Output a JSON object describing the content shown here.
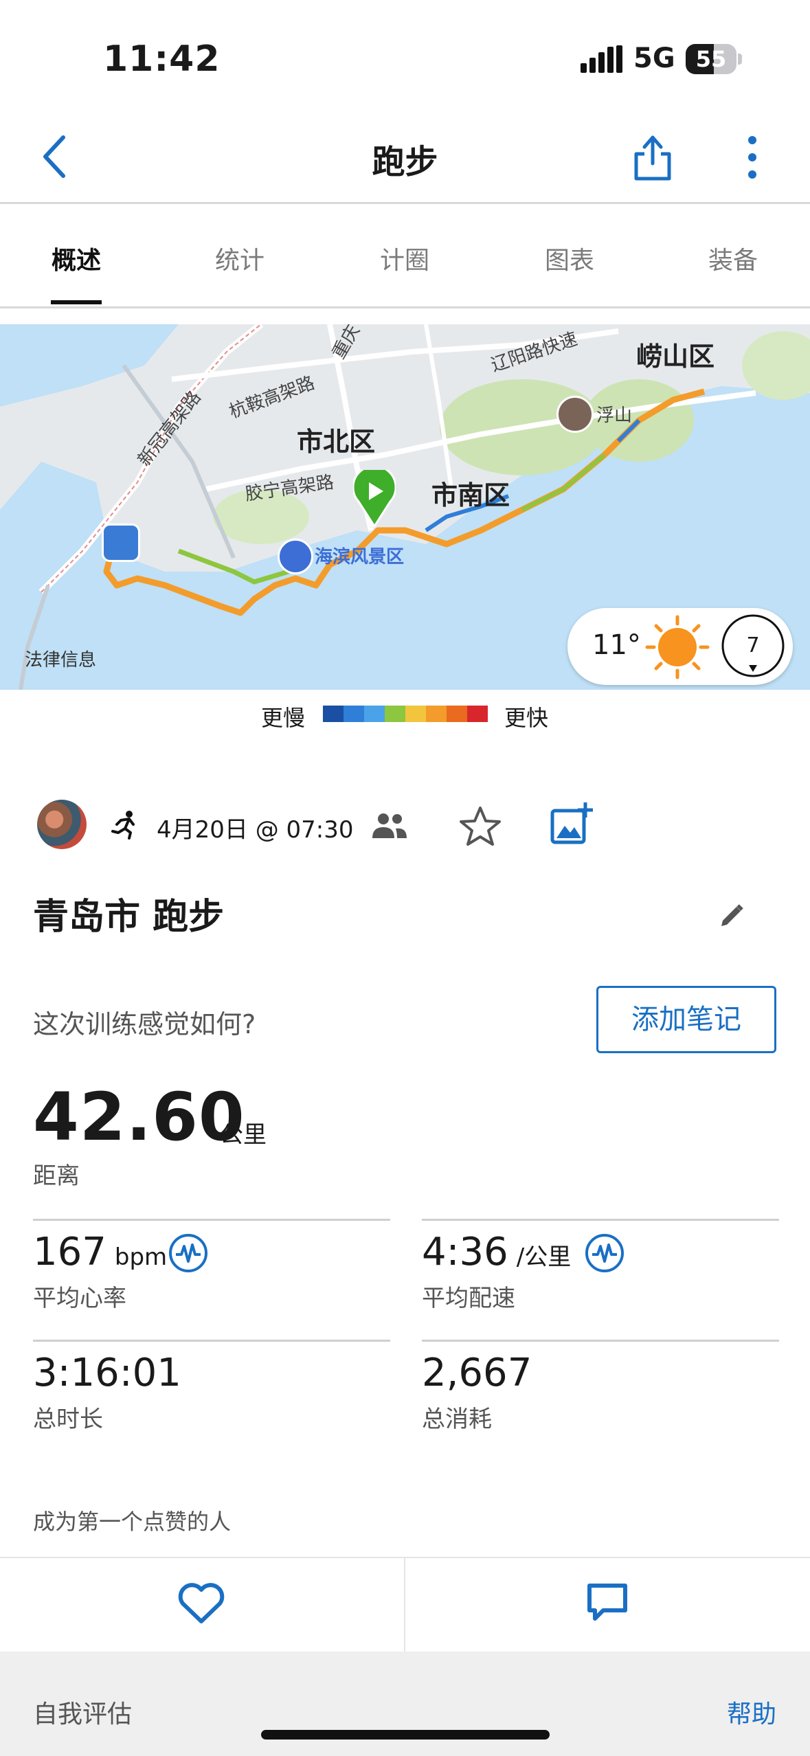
{
  "status_bar": {
    "time": "11:42",
    "network": "5G",
    "battery": "55",
    "battery_level": 0.55
  },
  "nav": {
    "title": "跑步"
  },
  "tabs": [
    {
      "label": "概述",
      "active": true
    },
    {
      "label": "统计",
      "active": false
    },
    {
      "label": "计圈",
      "active": false
    },
    {
      "label": "图表",
      "active": false
    },
    {
      "label": "装备",
      "active": false
    }
  ],
  "map": {
    "districts": [
      "市北区",
      "市南区",
      "崂山区"
    ],
    "roads": [
      "杭鞍高架路",
      "新冠高架路",
      "胶宁高架路",
      "辽阳路快速",
      "重庆"
    ],
    "poi": {
      "mountain": "浮山",
      "scenic": "海滨风景区"
    },
    "legal": "法律信息",
    "weather": {
      "temperature": "11°",
      "wind": "7",
      "icon": "sun-icon"
    }
  },
  "speed_legend": {
    "slower": "更慢",
    "faster": "更快",
    "colors": [
      "#1a4fa3",
      "#2f7fd8",
      "#4aa3e8",
      "#8dc63f",
      "#f2c53d",
      "#f39c2b",
      "#ea6a1f",
      "#d8262c"
    ]
  },
  "activity": {
    "date": "4月20日 @ 07:30",
    "title": "青岛市 跑步",
    "feel_question": "这次训练感觉如何?",
    "add_note": "添加笔记",
    "distance": {
      "value": "42.60",
      "unit": "公里",
      "label": "距离"
    },
    "heart_rate": {
      "value": "167",
      "unit": "bpm",
      "label": "平均心率"
    },
    "pace": {
      "value": "4:36",
      "unit": "/公里",
      "label": "平均配速"
    },
    "duration": {
      "value": "3:16:01",
      "label": "总时长"
    },
    "calories": {
      "value": "2,667",
      "label": "总消耗"
    },
    "likes_text": "成为第一个点赞的人"
  },
  "self_assessment": {
    "label": "自我评估",
    "help": "帮助"
  },
  "colors": {
    "accent": "#1a6fc4",
    "start_marker": "#3fae2a"
  }
}
